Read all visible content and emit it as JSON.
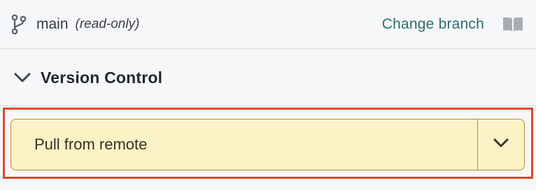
{
  "branch": {
    "name": "main",
    "mode": "(read-only)",
    "change_label": "Change branch"
  },
  "section": {
    "title": "Version Control"
  },
  "action": {
    "label": "Pull from remote"
  },
  "colors": {
    "accent_link": "#2c6d6b",
    "button_fill": "#fbf2c6",
    "button_border": "#c4862f",
    "highlight": "#e0492a"
  },
  "icons": {
    "branch": "git-branch-icon",
    "docs": "book-icon",
    "collapse": "chevron-down-icon",
    "dropdown": "chevron-down-icon"
  }
}
